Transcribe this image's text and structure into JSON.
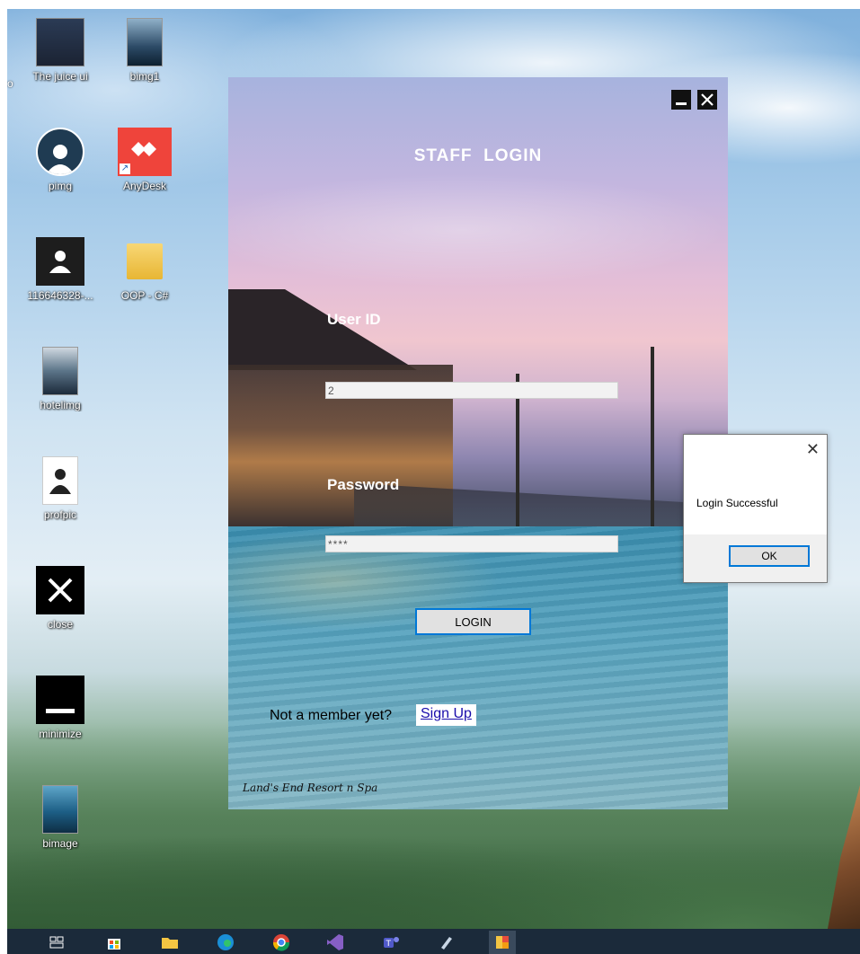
{
  "desktop": {
    "icons": [
      {
        "label": "The juice ui",
        "icon": "photo-thumbnail-icon"
      },
      {
        "label": "bimg1",
        "icon": "photo-thumbnail-icon"
      },
      {
        "label": "pimg",
        "icon": "user-avatar-icon"
      },
      {
        "label": "AnyDesk",
        "icon": "anydesk-icon"
      },
      {
        "label": "116646328-...",
        "icon": "user-avatar-icon"
      },
      {
        "label": "OOP - C#",
        "icon": "folder-icon"
      },
      {
        "label": "hotelimg",
        "icon": "photo-thumbnail-icon"
      },
      {
        "label": "profpic",
        "icon": "person-icon"
      },
      {
        "label": "close",
        "icon": "close-icon"
      },
      {
        "label": "minimize",
        "icon": "minimize-icon"
      },
      {
        "label": "bimage",
        "icon": "photo-thumbnail-icon"
      }
    ],
    "edge_label": "o"
  },
  "login_window": {
    "title": "STAFF  LOGIN",
    "user_label": "User ID",
    "user_value": "2",
    "password_label": "Password",
    "password_value": "****",
    "login_button": "LOGIN",
    "member_text": "Not a member yet?",
    "signup_link": "Sign Up",
    "brand": "Land's End Resort n Spa"
  },
  "message_box": {
    "text": "Login Successful",
    "ok_button": "OK",
    "close_glyph": "✕"
  },
  "taskbar": {
    "items": [
      "task-view-icon",
      "store-icon",
      "file-explorer-icon",
      "edge-icon",
      "chrome-icon",
      "visual-studio-icon",
      "teams-icon",
      "pen-icon",
      "app-window-icon"
    ]
  },
  "colors": {
    "accent": "#0078d7",
    "link": "#1a0dab",
    "taskbar": "#1b2a3a"
  }
}
